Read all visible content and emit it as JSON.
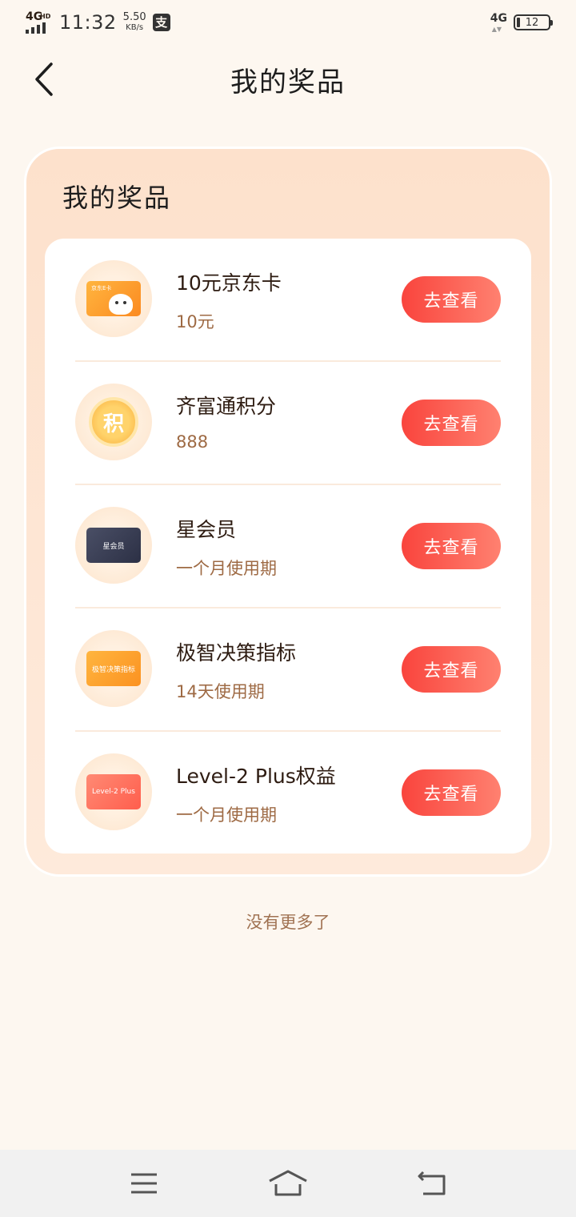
{
  "status_bar": {
    "network": "4G",
    "network_sup": "HD",
    "time": "11:32",
    "speed_value": "5.50",
    "speed_unit": "KB/s",
    "app_badge": "支",
    "right_network": "4G",
    "battery": "12"
  },
  "nav": {
    "title": "我的奖品",
    "back_icon": "chevron-left-icon"
  },
  "card": {
    "title": "我的奖品"
  },
  "prizes": [
    {
      "name": "10元京东卡",
      "desc": "10元",
      "button": "去查看",
      "icon": "jd-card-icon",
      "thumb_label": "京东E卡"
    },
    {
      "name": "齐富通积分",
      "desc": "888",
      "button": "去查看",
      "icon": "points-coin-icon",
      "thumb_label": "积"
    },
    {
      "name": "星会员",
      "desc": "一个月使用期",
      "button": "去查看",
      "icon": "star-member-card-icon",
      "thumb_label": "星会员"
    },
    {
      "name": "极智决策指标",
      "desc": "14天使用期",
      "button": "去查看",
      "icon": "decision-indicator-card-icon",
      "thumb_label": "极智决策指标"
    },
    {
      "name": "Level-2 Plus权益",
      "desc": "一个月使用期",
      "button": "去查看",
      "icon": "level2-card-icon",
      "thumb_label": "Level-2 Plus"
    }
  ],
  "footer": {
    "no_more": "没有更多了"
  },
  "system_nav": {
    "menu_icon": "menu-icon",
    "home_icon": "home-icon",
    "back_icon": "back-icon"
  },
  "colors": {
    "background": "#fdf7f0",
    "accent_button": "#f9443d",
    "desc_text": "#9e6a44"
  }
}
